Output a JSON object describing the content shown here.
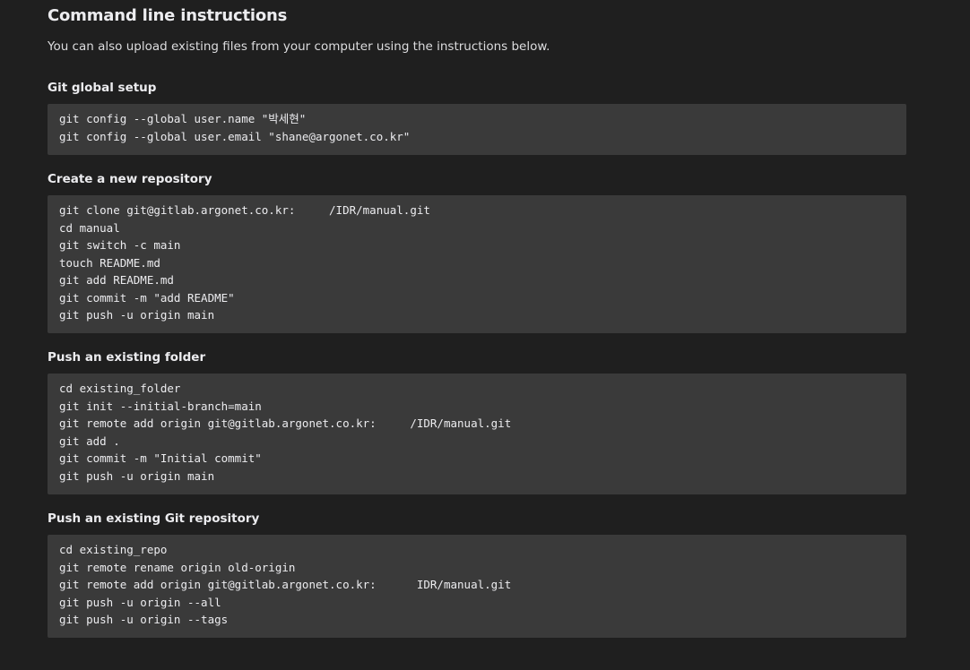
{
  "page": {
    "title": "Command line instructions",
    "intro": "You can also upload existing files from your computer using the instructions below."
  },
  "sections": [
    {
      "title": "Git global setup",
      "lines": [
        "git config --global user.name \"박세현\"",
        "git config --global user.email \"shane@argonet.co.kr\""
      ]
    },
    {
      "title": "Create a new repository",
      "lines": [
        "git clone git@gitlab.argonet.co.kr:     /IDR/manual.git",
        "cd manual",
        "git switch -c main",
        "touch README.md",
        "git add README.md",
        "git commit -m \"add README\"",
        "git push -u origin main"
      ]
    },
    {
      "title": "Push an existing folder",
      "lines": [
        "cd existing_folder",
        "git init --initial-branch=main",
        "git remote add origin git@gitlab.argonet.co.kr:     /IDR/manual.git",
        "git add .",
        "git commit -m \"Initial commit\"",
        "git push -u origin main"
      ]
    },
    {
      "title": "Push an existing Git repository",
      "lines": [
        "cd existing_repo",
        "git remote rename origin old-origin",
        "git remote add origin git@gitlab.argonet.co.kr:      IDR/manual.git",
        "git push -u origin --all",
        "git push -u origin --tags"
      ]
    }
  ]
}
